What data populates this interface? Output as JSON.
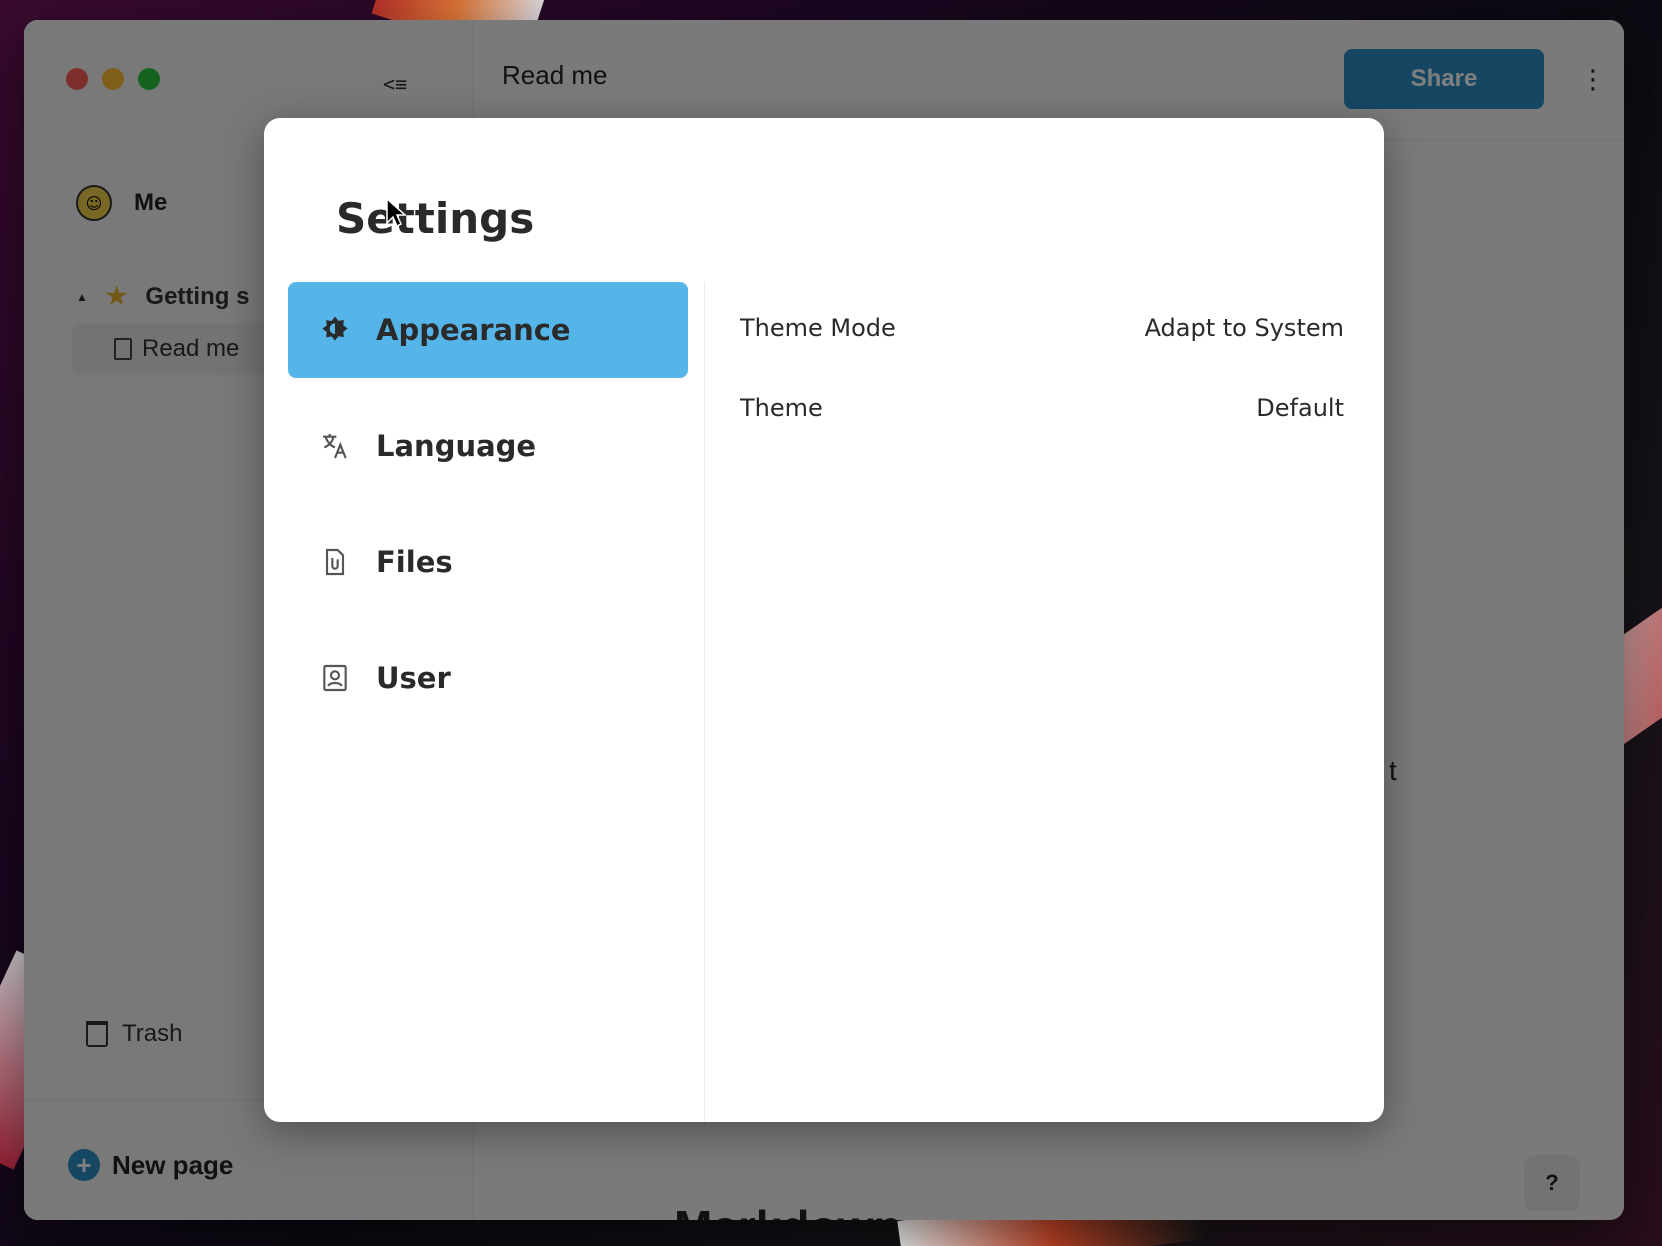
{
  "window": {
    "document_title": "Read me",
    "share_label": "Share",
    "more_label": "⋮",
    "help_label": "?",
    "content_fragment": "t",
    "content_heading": "Markdown"
  },
  "sidebar": {
    "user_name": "Me",
    "group_label": "Getting s",
    "page_label": "Read me",
    "trash_label": "Trash",
    "new_page_label": "New page"
  },
  "settings": {
    "title": "Settings",
    "nav": [
      {
        "label": "Appearance",
        "icon": "brightness-icon",
        "active": true
      },
      {
        "label": "Language",
        "icon": "translate-icon",
        "active": false
      },
      {
        "label": "Files",
        "icon": "file-icon",
        "active": false
      },
      {
        "label": "User",
        "icon": "user-icon",
        "active": false
      }
    ],
    "rows": [
      {
        "label": "Theme Mode",
        "value": "Adapt to System"
      },
      {
        "label": "Theme",
        "value": "Default"
      }
    ]
  },
  "colors": {
    "accent": "#55b5e8",
    "share_button": "#2b8fc7",
    "traffic_red": "#ff5f57",
    "traffic_yellow": "#febc2e",
    "traffic_green": "#28c840"
  }
}
